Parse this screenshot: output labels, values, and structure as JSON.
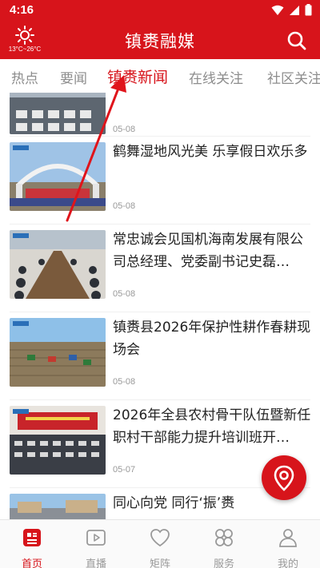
{
  "status_bar": {
    "time": "4:16"
  },
  "header": {
    "title": "镇赉融媒",
    "weather_temp": "13°C~26°C"
  },
  "tabs": [
    {
      "label": "热点"
    },
    {
      "label": "要闻"
    },
    {
      "label": "镇赉新闻",
      "active": true
    },
    {
      "label": "在线关注"
    },
    {
      "label": "社区关注"
    }
  ],
  "news": [
    {
      "title": "",
      "date": "05-08"
    },
    {
      "title": "鹤舞湿地风光美 乐享假日欢乐多",
      "date": "05-08"
    },
    {
      "title": "常忠诚会见国机海南发展有限公司总经理、党委副书记史磊…",
      "date": "05-08"
    },
    {
      "title": "镇赉县2026年保护性耕作春耕现场会",
      "date": "05-08"
    },
    {
      "title": "2026年全县农村骨干队伍暨新任职村干部能力提升培训班开…",
      "date": "05-07"
    },
    {
      "title": "同心向党 同行‘振’赉",
      "date": ""
    }
  ],
  "bottom_nav": [
    {
      "label": "首页",
      "icon": "home-news-icon",
      "active": true
    },
    {
      "label": "直播",
      "icon": "live-play-icon"
    },
    {
      "label": "矩阵",
      "icon": "heart-icon"
    },
    {
      "label": "服务",
      "icon": "services-grid-icon"
    },
    {
      "label": "我的",
      "icon": "user-icon"
    }
  ],
  "colors": {
    "brand": "#d7141b",
    "inactive": "#999999"
  }
}
